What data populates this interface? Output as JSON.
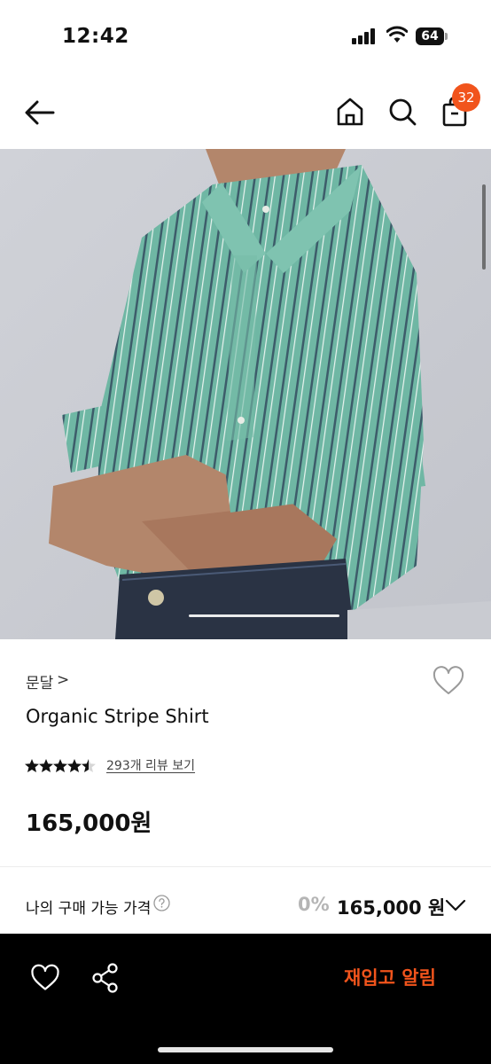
{
  "status_bar": {
    "time": "12:42",
    "battery_level": "64"
  },
  "header": {
    "back_icon": "arrow-left-icon",
    "home_icon": "home-icon",
    "search_icon": "search-icon",
    "cart_icon": "shopping-bag-icon",
    "cart_count": "32"
  },
  "product": {
    "brand": "문달",
    "brand_chevron": ">",
    "title": "Organic Stripe Shirt",
    "rating_stars": 4.5,
    "review_link": "293개 리뷰 보기",
    "price": "165,000원",
    "image_colors": {
      "background": "#c9cbd1",
      "shirt": "#6fb7a4",
      "stripe": "#3d5c6a",
      "skin": "#b3866b",
      "jeans": "#2a3344"
    }
  },
  "my_price": {
    "label": "나의 구매 가능 가격",
    "help_icon": "question-circle-icon",
    "discount": "0%",
    "price": "165,000 원",
    "expand_icon": "chevron-down-icon"
  },
  "bottom_bar": {
    "wish_icon": "heart-icon",
    "share_icon": "share-icon",
    "restock_label": "재입고 알림"
  },
  "colors": {
    "accent": "#f1541c",
    "bottom_bar_bg": "#000000",
    "muted": "#b5b5b5"
  }
}
